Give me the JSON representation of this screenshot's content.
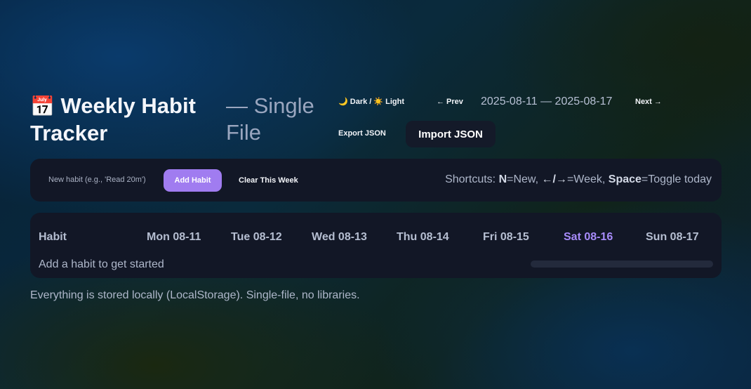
{
  "header": {
    "icon": "📅",
    "title": "Weekly Habit Tracker",
    "subtitle": "— Single File",
    "theme_toggle": "🌙 Dark / ☀️ Light",
    "prev_label": "← Prev",
    "week_range": "2025-08-11 — 2025-08-17",
    "next_label": "Next →",
    "export_label": "Export JSON",
    "import_label": "Import JSON"
  },
  "toolbar": {
    "habit_placeholder": "New habit (e.g., 'Read 20m')",
    "add_label": "Add Habit",
    "clear_label": "Clear This Week",
    "shortcuts": {
      "prefix": "Shortcuts: ",
      "key_new": "N",
      "label_new": "=New, ",
      "key_week": "←/→",
      "label_week": "=Week, ",
      "key_toggle": "Space",
      "label_toggle": "=Toggle today"
    }
  },
  "table": {
    "habit_header": "Habit",
    "days": [
      {
        "label": "Mon 08-11",
        "today": false
      },
      {
        "label": "Tue 08-12",
        "today": false
      },
      {
        "label": "Wed 08-13",
        "today": false
      },
      {
        "label": "Thu 08-14",
        "today": false
      },
      {
        "label": "Fri 08-15",
        "today": false
      },
      {
        "label": "Sat 08-16",
        "today": true
      },
      {
        "label": "Sun 08-17",
        "today": false
      }
    ],
    "empty_message": "Add a habit to get started"
  },
  "footer": {
    "note": "Everything is stored locally (LocalStorage). Single-file, no libraries."
  },
  "colors": {
    "accent": "#a07cf0",
    "today": "#a78bfa",
    "card": "#121726"
  }
}
